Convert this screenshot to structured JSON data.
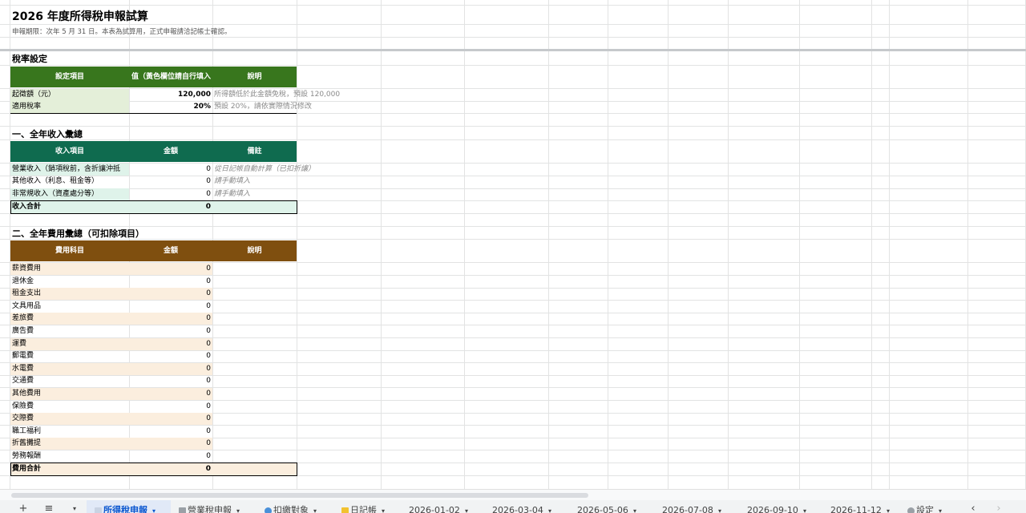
{
  "sheet": {
    "title": "2026 年度所得稅申報試算",
    "subtitle": "申報期限：次年 5 月 31 日。本表為試算用，正式申報請洽記帳士確認。"
  },
  "tax_settings": {
    "section_title": "稅率設定",
    "headers": [
      "設定項目",
      "值（黃色欄位請自行填入",
      "說明"
    ],
    "rows": [
      {
        "label": "起徵額（元）",
        "value": "120,000",
        "note": "所得額低於此金額免稅，預設 120,000"
      },
      {
        "label": "適用稅率",
        "value": "20%",
        "note": "預設 20%，請依實際情況修改"
      }
    ],
    "header_color": "#38761d"
  },
  "income": {
    "section_title": "一、全年收入彙總",
    "headers": [
      "收入項目",
      "金額",
      "備註"
    ],
    "rows": [
      {
        "label": "營業收入（銷項稅前，含折讓沖抵",
        "value": "0",
        "note": "從日記帳自動計算（已扣折讓）"
      },
      {
        "label": "其他收入（利息、租金等）",
        "value": "0",
        "note": "請手動填入"
      },
      {
        "label": "非常規收入（資產處分等）",
        "value": "0",
        "note": "請手動填入"
      }
    ],
    "total_label": "收入合計",
    "total_value": "0",
    "header_color": "#0f6b4f"
  },
  "expenses": {
    "section_title": "二、全年費用彙總（可扣除項目）",
    "headers": [
      "費用科目",
      "金額",
      "說明"
    ],
    "rows": [
      {
        "label": "薪資費用",
        "value": "0"
      },
      {
        "label": "退休金",
        "value": "0"
      },
      {
        "label": "租金支出",
        "value": "0"
      },
      {
        "label": "文具用品",
        "value": "0"
      },
      {
        "label": "差旅費",
        "value": "0"
      },
      {
        "label": "廣告費",
        "value": "0"
      },
      {
        "label": "運費",
        "value": "0"
      },
      {
        "label": "郵電費",
        "value": "0"
      },
      {
        "label": "水電費",
        "value": "0"
      },
      {
        "label": "交通費",
        "value": "0"
      },
      {
        "label": "其他費用",
        "value": "0"
      },
      {
        "label": "保險費",
        "value": "0"
      },
      {
        "label": "交際費",
        "value": "0"
      },
      {
        "label": "職工福利",
        "value": "0"
      },
      {
        "label": "折舊攤提",
        "value": "0"
      },
      {
        "label": "勞務報酬",
        "value": "0"
      }
    ],
    "total_label": "費用合計",
    "total_value": "0",
    "header_color": "#7f4f0f"
  },
  "tabbar": {
    "add_icon": "+",
    "menu_icon": "≡",
    "tabs": [
      {
        "label": "所得稅申報",
        "icon": "document-icon",
        "active": true
      },
      {
        "label": "營業稅申報",
        "icon": "table-icon",
        "active": false
      },
      {
        "label": "扣繳對象",
        "icon": "people-icon",
        "active": false
      },
      {
        "label": "日記帳",
        "icon": "folder-icon",
        "active": false
      },
      {
        "label": "2026-01-02",
        "active": false
      },
      {
        "label": "2026-03-04",
        "active": false
      },
      {
        "label": "2026-05-06",
        "active": false
      },
      {
        "label": "2026-07-08",
        "active": false
      },
      {
        "label": "2026-09-10",
        "active": false
      },
      {
        "label": "2026-11-12",
        "active": false
      },
      {
        "label": "設定",
        "icon": "gear-icon",
        "active": false
      }
    ],
    "prev_icon": "‹",
    "next_icon": "›"
  },
  "colors": {
    "settings_label_bg": "#e4efd9",
    "income_label_bg": "#dff3ea",
    "expense_label_bg": "#fbeede",
    "active_tab": "#0b57d0"
  }
}
